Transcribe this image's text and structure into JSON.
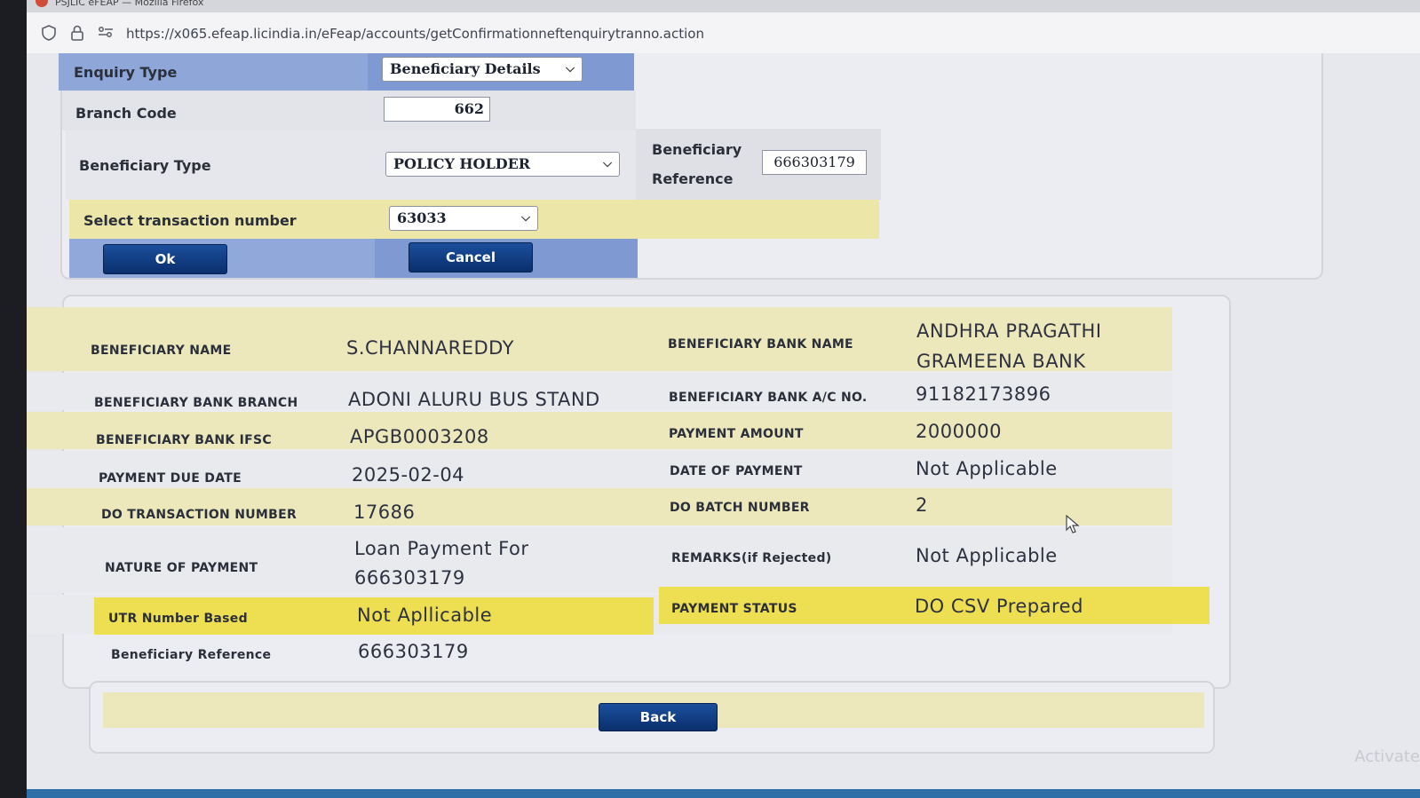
{
  "browser": {
    "title": "PSJLIC eFEAP — Mozilla Firefox",
    "url": "https://x065.efeap.licindia.in/eFeap/accounts/getConfirmationneftenquirytranno.action"
  },
  "form": {
    "enquiry_type_label": "Enquiry Type",
    "enquiry_type_value": "Beneficiary Details",
    "branch_code_label": "Branch Code",
    "branch_code_value": "662",
    "beneficiary_type_label": "Beneficiary Type",
    "beneficiary_type_value": "POLICY HOLDER",
    "beneficiary_reference_label_1": "Beneficiary",
    "beneficiary_reference_label_2": "Reference",
    "beneficiary_reference_value": "666303179",
    "transaction_label": "Select transaction number",
    "transaction_value": "63033",
    "ok_label": "Ok",
    "cancel_label": "Cancel"
  },
  "details": {
    "beneficiary_name_label": "BENEFICIARY NAME",
    "beneficiary_name": "S.CHANNAREDDY",
    "bank_name_label": "BENEFICIARY BANK NAME",
    "bank_name_1": "ANDHRA PRAGATHI",
    "bank_name_2": "GRAMEENA BANK",
    "bank_branch_label": "BENEFICIARY BANK BRANCH",
    "bank_branch": "ADONI ALURU BUS STAND",
    "account_no_label": "BENEFICIARY BANK A/C NO.",
    "account_no": "91182173896",
    "ifsc_label": "BENEFICIARY BANK IFSC",
    "ifsc": "APGB0003208",
    "amount_label": "PAYMENT AMOUNT",
    "amount": "2000000",
    "due_date_label": "PAYMENT DUE DATE",
    "due_date": "2025-02-04",
    "date_of_payment_label": "DATE OF PAYMENT",
    "date_of_payment": "Not Applicable",
    "do_txn_label": "DO TRANSACTION NUMBER",
    "do_txn": "17686",
    "do_batch_label": "DO BATCH NUMBER",
    "do_batch": "2",
    "nature_label": "NATURE OF PAYMENT",
    "nature_1": "Loan Payment For",
    "nature_2": "666303179",
    "remarks_label": "REMARKS(if Rejected)",
    "remarks": "Not Applicable",
    "utr_label": "UTR Number Based",
    "utr": "Not Apllicable",
    "status_label": "PAYMENT STATUS",
    "status": "DO CSV Prepared",
    "ref_label": "Beneficiary Reference",
    "ref": "666303179"
  },
  "back_label": "Back",
  "watermark": "Activate"
}
